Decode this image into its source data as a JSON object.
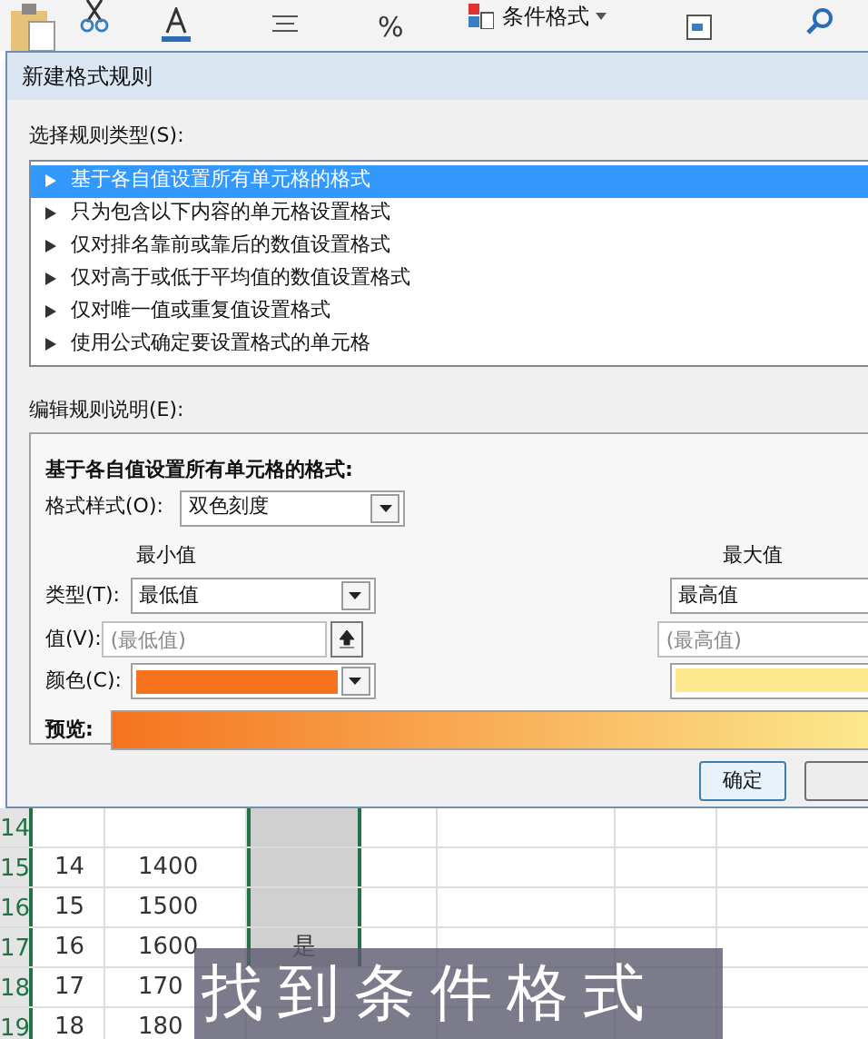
{
  "ribbon": {
    "percent": "%",
    "conditional_format": "条件格式"
  },
  "dialog": {
    "title": "新建格式规则",
    "rule_type_label": "选择规则类型(S):",
    "rule_types": [
      {
        "label": "基于各自值设置所有单元格的格式",
        "selected": true
      },
      {
        "label": "只为包含以下内容的单元格设置格式",
        "selected": false
      },
      {
        "label": "仅对排名靠前或靠后的数值设置格式",
        "selected": false
      },
      {
        "label": "仅对高于或低于平均值的数值设置格式",
        "selected": false
      },
      {
        "label": "仅对唯一值或重复值设置格式",
        "selected": false
      },
      {
        "label": "使用公式确定要设置格式的单元格",
        "selected": false
      }
    ],
    "edit_label": "编辑规则说明(E):",
    "heading": "基于各自值设置所有单元格的格式:",
    "format_style_label": "格式样式(O):",
    "format_style": "双色刻度",
    "min_header": "最小值",
    "max_header": "最大值",
    "type_label": "类型(T):",
    "min_type": "最低值",
    "max_type": "最高值",
    "value_label": "值(V):",
    "min_value_placeholder": "(最低值)",
    "max_value_placeholder": "(最高值)",
    "color_label": "颜色(C):",
    "min_swatch": {
      "color": "#f5731f"
    },
    "max_swatch": {
      "color": "#fce98e"
    },
    "preview_label": "预览:",
    "ok": "确定"
  },
  "sheet": {
    "rows": [
      {
        "number": "14",
        "a": "",
        "b": "",
        "c": ""
      },
      {
        "number": "15",
        "a": "14",
        "b": "1400",
        "c": ""
      },
      {
        "number": "16",
        "a": "15",
        "b": "1500",
        "c": ""
      },
      {
        "number": "17",
        "a": "16",
        "b": "1600",
        "c": "是"
      },
      {
        "number": "18",
        "a": "17",
        "b": "170",
        "c": ""
      },
      {
        "number": "19",
        "a": "18",
        "b": "180",
        "c": ""
      }
    ]
  },
  "subtitle": "找到条件格式"
}
